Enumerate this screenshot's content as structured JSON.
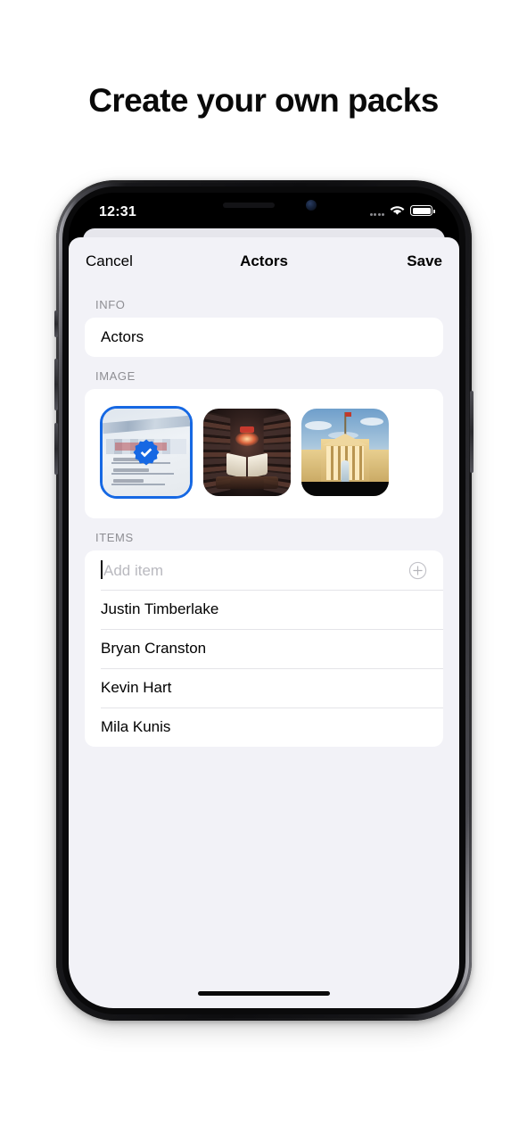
{
  "headline": "Create your own packs",
  "status_bar": {
    "time": "12:31",
    "signal_icon": "signal-dots-icon",
    "wifi_icon": "wifi-icon",
    "battery_icon": "battery-full-icon"
  },
  "navbar": {
    "cancel_label": "Cancel",
    "title": "Actors",
    "save_label": "Save"
  },
  "sections": {
    "info": {
      "header": "INFO",
      "value": "Actors"
    },
    "image": {
      "header": "IMAGE",
      "thumbnails": [
        {
          "name": "clapperboard-thumbnail",
          "selected": true,
          "badge_icon": "check-badge-icon"
        },
        {
          "name": "library-thumbnail",
          "selected": false
        },
        {
          "name": "white-house-thumbnail",
          "selected": false
        }
      ]
    },
    "items": {
      "header": "ITEMS",
      "add_placeholder": "Add item",
      "add_icon": "circle-plus-icon",
      "list": [
        "Justin Timberlake",
        "Bryan Cranston",
        "Kevin Hart",
        "Mila Kunis"
      ]
    }
  },
  "colors": {
    "accent": "#1668e3",
    "background": "#f2f2f7",
    "card": "#ffffff",
    "section_header": "#8e8e93",
    "placeholder": "#b9b9bf",
    "divider": "#e4e4e8"
  }
}
